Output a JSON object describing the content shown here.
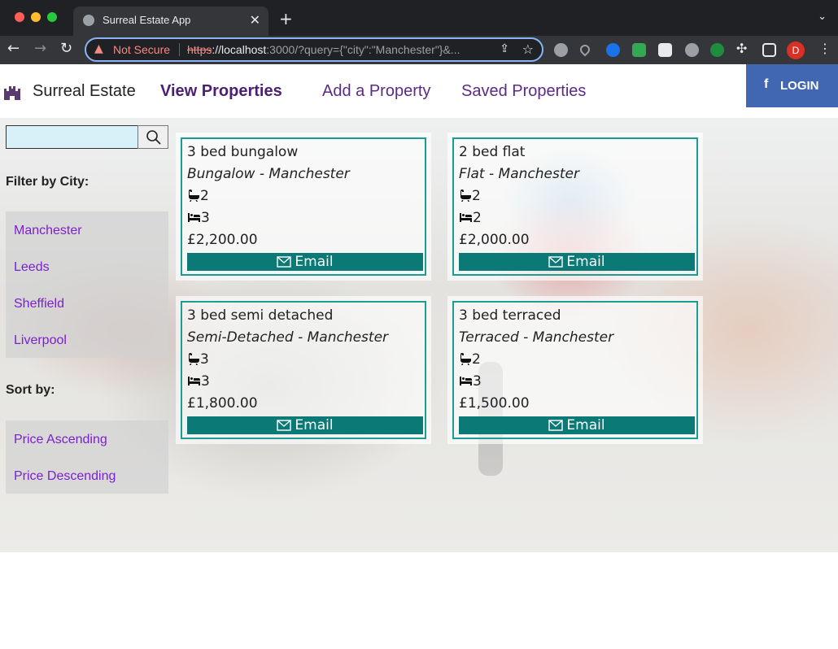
{
  "browser": {
    "tab_title": "Surreal Estate App",
    "not_secure": "Not Secure",
    "url_scheme": "https",
    "url_host": "://localhost",
    "url_rest": ":3000/?query={\"city\":\"Manchester\"}&...",
    "profile_initial": "D"
  },
  "nav": {
    "brand": "Surreal Estate",
    "links": [
      "View Properties",
      "Add a Property",
      "Saved Properties"
    ],
    "login": "LOGIN"
  },
  "sidebar": {
    "search_value": "",
    "filter_label": "Filter by City:",
    "cities": [
      "Manchester",
      "Leeds",
      "Sheffield",
      "Liverpool"
    ],
    "sort_label": "Sort by:",
    "sorts": [
      "Price Ascending",
      "Price Descending"
    ]
  },
  "properties": [
    {
      "title": "3 bed bungalow",
      "subtitle": "Bungalow - Manchester",
      "bathrooms": "2",
      "bedrooms": "3",
      "price": "£2,200.00",
      "email": "Email"
    },
    {
      "title": "2 bed flat",
      "subtitle": "Flat - Manchester",
      "bathrooms": "2",
      "bedrooms": "2",
      "price": "£2,000.00",
      "email": "Email"
    },
    {
      "title": "3 bed semi detached",
      "subtitle": "Semi-Detached - Manchester",
      "bathrooms": "3",
      "bedrooms": "3",
      "price": "£1,800.00",
      "email": "Email"
    },
    {
      "title": "3 bed terraced",
      "subtitle": "Terraced - Manchester",
      "bathrooms": "2",
      "bedrooms": "3",
      "price": "£1,500.00",
      "email": "Email"
    }
  ],
  "colors": {
    "accent_teal": "#0b7a76",
    "nav_purple": "#5b2a86",
    "link_purple": "#7b1fd1",
    "facebook_blue": "#4267b2"
  },
  "icons": {
    "bath": "bath-icon",
    "bed": "bed-icon",
    "email": "envelope-icon",
    "search": "search-icon",
    "brand": "castle-icon",
    "login": "facebook-icon"
  }
}
